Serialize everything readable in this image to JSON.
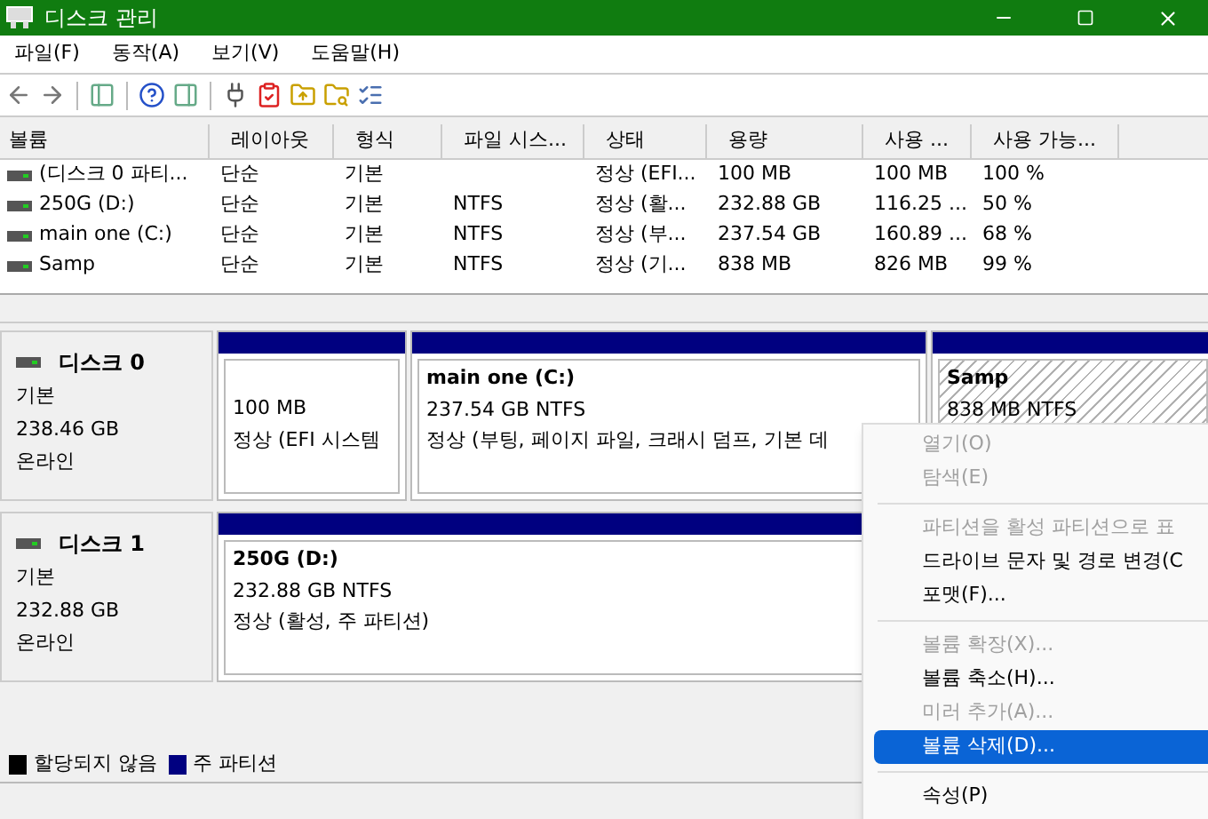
{
  "window": {
    "title": "디스크 관리"
  },
  "menu": [
    "파일(F)",
    "동작(A)",
    "보기(V)",
    "도움말(H)"
  ],
  "table": {
    "columns": [
      "볼륨",
      "레이아웃",
      "형식",
      "파일 시스...",
      "상태",
      "용량",
      "사용 ...",
      "사용 가능..."
    ],
    "rows": [
      [
        "(디스크 0 파티...",
        "단순",
        "기본",
        "",
        "정상 (EFI...",
        "100 MB",
        "100 MB",
        "100 %"
      ],
      [
        "250G (D:)",
        "단순",
        "기본",
        "NTFS",
        "정상 (활...",
        "232.88 GB",
        "116.25 ...",
        "50 %"
      ],
      [
        "main one (C:)",
        "단순",
        "기본",
        "NTFS",
        "정상 (부...",
        "237.54 GB",
        "160.89 ...",
        "68 %"
      ],
      [
        "Samp",
        "단순",
        "기본",
        "NTFS",
        "정상 (기...",
        "838 MB",
        "826 MB",
        "99 %"
      ]
    ]
  },
  "disks": [
    {
      "name": "디스크 0",
      "type": "기본",
      "size": "238.46 GB",
      "state": "온라인",
      "partitions": [
        {
          "size": "100 MB",
          "status": "정상 (EFI 시스템",
          "selected": false
        },
        {
          "label": "main one  (C:)",
          "size": "237.54 GB NTFS",
          "status": "정상 (부팅, 페이지 파일, 크래시 덤프, 기본 데",
          "selected": false
        },
        {
          "label": "Samp",
          "size": "838 MB NTFS",
          "selected": true
        }
      ]
    },
    {
      "name": "디스크 1",
      "type": "기본",
      "size": "232.88 GB",
      "state": "온라인",
      "partitions": [
        {
          "label": "250G  (D:)",
          "size": "232.88 GB NTFS",
          "status": "정상 (활성, 주 파티션)",
          "selected": false
        }
      ]
    }
  ],
  "legend": [
    {
      "label": "할당되지 않음",
      "color": "#000000"
    },
    {
      "label": "주 파티션",
      "color": "#000080"
    }
  ],
  "context_menu": [
    {
      "kind": "item",
      "label": "열기(O)",
      "disabled": true,
      "selected": false
    },
    {
      "kind": "item",
      "label": "탐색(E)",
      "disabled": true,
      "selected": false
    },
    {
      "kind": "separator"
    },
    {
      "kind": "item",
      "label": "파티션을 활성 파티션으로 표",
      "disabled": true,
      "selected": false
    },
    {
      "kind": "item",
      "label": "드라이브 문자 및 경로 변경(C",
      "disabled": false,
      "selected": false
    },
    {
      "kind": "item",
      "label": "포맷(F)...",
      "disabled": false,
      "selected": false
    },
    {
      "kind": "separator"
    },
    {
      "kind": "item",
      "label": "볼륨 확장(X)...",
      "disabled": true,
      "selected": false
    },
    {
      "kind": "item",
      "label": "볼륨 축소(H)...",
      "disabled": false,
      "selected": false
    },
    {
      "kind": "item",
      "label": "미러 추가(A)...",
      "disabled": true,
      "selected": false
    },
    {
      "kind": "item",
      "label": "볼륨 삭제(D)...",
      "disabled": false,
      "selected": true
    },
    {
      "kind": "separator"
    },
    {
      "kind": "item",
      "label": "속성(P)",
      "disabled": false,
      "selected": false
    }
  ]
}
